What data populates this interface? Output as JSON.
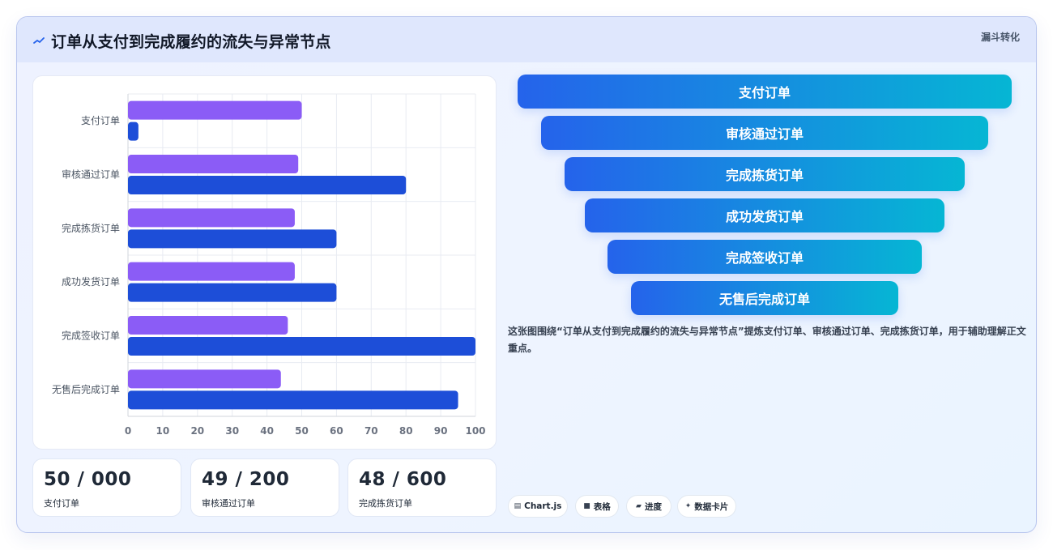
{
  "header": {
    "title": "订单从支付到完成履约的流失与异常节点",
    "tag": "漏斗转化"
  },
  "chart_data": {
    "type": "bar",
    "orientation": "horizontal",
    "categories": [
      "支付订单",
      "审核通过订单",
      "完成拣货订单",
      "成功发货订单",
      "完成签收订单",
      "无售后完成订单"
    ],
    "series": [
      {
        "values": [
          50,
          49,
          48,
          48,
          46,
          44
        ],
        "color": "#8b5cf6"
      },
      {
        "values": [
          3,
          80,
          60,
          60,
          100,
          95
        ],
        "color": "#1d4ed8"
      }
    ],
    "xlim": [
      0,
      100
    ],
    "xticks": [
      0,
      10,
      20,
      30,
      40,
      50,
      60,
      70,
      80,
      90,
      100
    ],
    "grid": true
  },
  "stats": [
    {
      "value": "50 / 000",
      "label": "支付订单",
      "color": "#1d4ed8"
    },
    {
      "value": "49 / 200",
      "label": "审核通过订单",
      "color": "#4338ca"
    },
    {
      "value": "48 / 600",
      "label": "完成拣货订单",
      "color": "#8b5cf6"
    }
  ],
  "funnel": [
    "支付订单",
    "审核通过订单",
    "完成拣货订单",
    "成功发货订单",
    "完成签收订单",
    "无售后完成订单"
  ],
  "description": "这张图围绕“订单从支付到完成履约的流失与异常节点”提炼支付订单、审核通过订单、完成拣货订单，用于辅助理解正文重点。",
  "chips": [
    {
      "icon": "▤",
      "label": "Chart.js"
    },
    {
      "icon": "■",
      "label": "表格"
    },
    {
      "icon": "▰",
      "label": "进度"
    },
    {
      "icon": "✦",
      "label": "数据卡片"
    }
  ]
}
